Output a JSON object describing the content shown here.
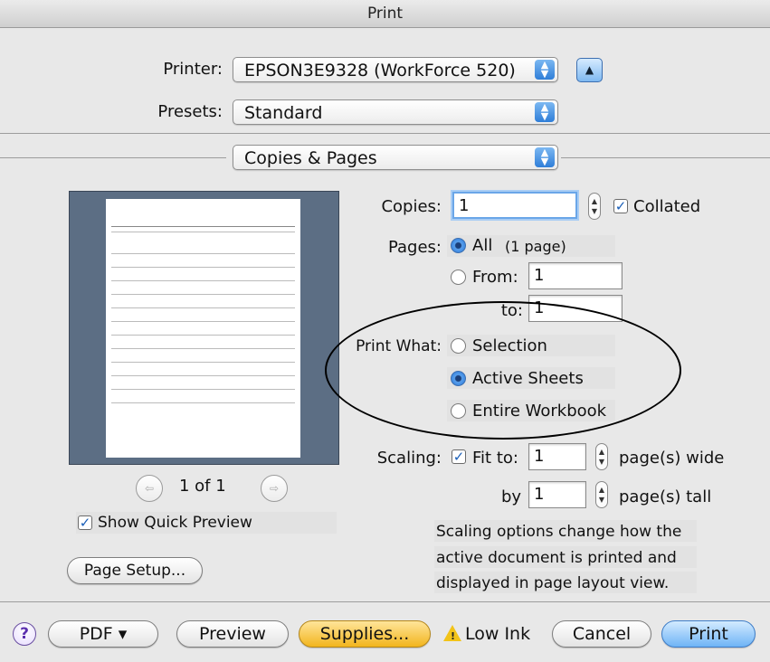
{
  "window": {
    "title": "Print"
  },
  "printer": {
    "label": "Printer:",
    "value": "EPSON3E9328 (WorkForce 520)"
  },
  "presets": {
    "label": "Presets:",
    "value": "Standard"
  },
  "section": {
    "value": "Copies & Pages"
  },
  "copies": {
    "label": "Copies:",
    "value": "1",
    "collated_label": "Collated",
    "collated": true
  },
  "pages": {
    "label": "Pages:",
    "all_label": "All",
    "all_note": "(1 page)",
    "from_label": "From:",
    "from_value": "1",
    "to_label": "to:",
    "to_value": "1",
    "selected": "all"
  },
  "print_what": {
    "label": "Print What:",
    "options": [
      "Selection",
      "Active Sheets",
      "Entire Workbook"
    ],
    "selected": "Active Sheets"
  },
  "scaling": {
    "label": "Scaling:",
    "fit_label": "Fit to:",
    "wide_value": "1",
    "wide_suffix": "page(s) wide",
    "by_label": "by",
    "tall_value": "1",
    "tall_suffix": "page(s) tall",
    "fit_checked": true,
    "note_line1": "Scaling options change how the",
    "note_line2": "active document is printed and",
    "note_line3": "displayed in page layout view."
  },
  "preview": {
    "page_indicator": "1 of 1",
    "quick_preview_label": "Show Quick Preview",
    "quick_preview": true
  },
  "page_setup": {
    "label": "Page Setup..."
  },
  "footer": {
    "help": "?",
    "pdf": "PDF ▾",
    "preview": "Preview",
    "supplies": "Supplies...",
    "low_ink": "Low Ink",
    "cancel": "Cancel",
    "print": "Print"
  },
  "colors": {
    "accent": "#3a86e0",
    "supplies": "#f2b51e",
    "preview_bg": "#5c6e84"
  }
}
